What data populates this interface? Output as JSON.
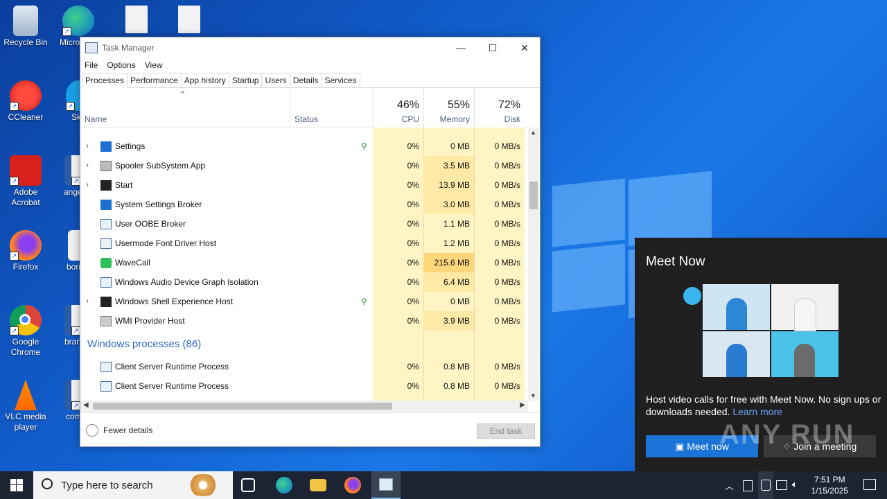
{
  "desktop": {
    "icons": [
      {
        "label": "Recycle Bin"
      },
      {
        "label": "Micro Edg"
      },
      {
        "label": "CCleaner"
      },
      {
        "label": "Sky"
      },
      {
        "label": "Adobe Acrobat"
      },
      {
        "label": "angeles"
      },
      {
        "label": "Firefox"
      },
      {
        "label": "bornfir"
      },
      {
        "label": "Google Chrome"
      },
      {
        "label": "brandst"
      },
      {
        "label": "VLC media player"
      },
      {
        "label": "compo"
      }
    ]
  },
  "taskmanager": {
    "title": "Task Manager",
    "menu": [
      "File",
      "Options",
      "View"
    ],
    "tabs": [
      "Processes",
      "Performance",
      "App history",
      "Startup",
      "Users",
      "Details",
      "Services"
    ],
    "columns": {
      "name": "Name",
      "status": "Status",
      "cpu": {
        "pct": "46%",
        "label": "CPU"
      },
      "memory": {
        "pct": "55%",
        "label": "Memory"
      },
      "disk": {
        "pct": "72%",
        "label": "Disk"
      }
    },
    "rows": [
      {
        "name": "Settings",
        "cpu": "0%",
        "mem": "0 MB",
        "disk": "0 MB/s"
      },
      {
        "name": "Spooler SubSystem App",
        "cpu": "0%",
        "mem": "3.5 MB",
        "disk": "0 MB/s"
      },
      {
        "name": "Start",
        "cpu": "0%",
        "mem": "13.9 MB",
        "disk": "0 MB/s"
      },
      {
        "name": "System Settings Broker",
        "cpu": "0%",
        "mem": "3.0 MB",
        "disk": "0 MB/s"
      },
      {
        "name": "User OOBE Broker",
        "cpu": "0%",
        "mem": "1.1 MB",
        "disk": "0 MB/s"
      },
      {
        "name": "Usermode Font Driver Host",
        "cpu": "0%",
        "mem": "1.2 MB",
        "disk": "0 MB/s"
      },
      {
        "name": "WaveCall",
        "cpu": "0%",
        "mem": "215.6 MB",
        "disk": "0 MB/s"
      },
      {
        "name": "Windows Audio Device Graph Isolation",
        "cpu": "0%",
        "mem": "6.4 MB",
        "disk": "0 MB/s"
      },
      {
        "name": "Windows Shell Experience Host",
        "cpu": "0%",
        "mem": "0 MB",
        "disk": "0 MB/s"
      },
      {
        "name": "WMI Provider Host",
        "cpu": "0%",
        "mem": "3.9 MB",
        "disk": "0 MB/s"
      }
    ],
    "group_label": "Windows processes (86)",
    "rows2": [
      {
        "name": "Client Server Runtime Process",
        "cpu": "0%",
        "mem": "0.8 MB",
        "disk": "0 MB/s"
      },
      {
        "name": "Client Server Runtime Process",
        "cpu": "0%",
        "mem": "0.8 MB",
        "disk": "0 MB/s"
      }
    ],
    "fewer_details": "Fewer details",
    "end_task": "End task"
  },
  "meetnow": {
    "title": "Meet Now",
    "description": "Host video calls for free with Meet Now. No sign ups or downloads needed.",
    "learn_more": "Learn more",
    "meet_button": "Meet now",
    "join_button": "Join a meeting",
    "watermark": "ANY RUN"
  },
  "taskbar": {
    "search_placeholder": "Type here to search",
    "time": "7:51 PM",
    "date": "1/15/2025"
  }
}
